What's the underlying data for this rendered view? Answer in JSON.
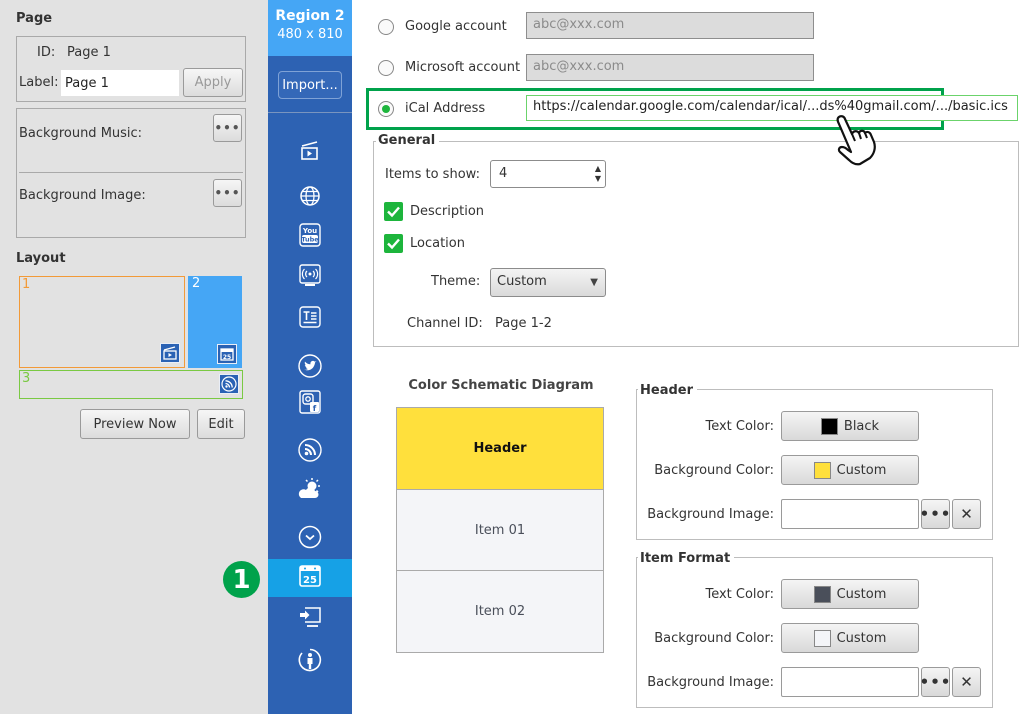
{
  "page_panel": {
    "title": "Page",
    "id_label": "ID:",
    "id_value": "Page 1",
    "label_label": "Label:",
    "label_value": "Page 1",
    "apply_button": "Apply",
    "bg_music_label": "Background Music:",
    "bg_image_label": "Background Image:",
    "browse_button": "•••"
  },
  "layout_panel": {
    "title": "Layout",
    "regions": [
      {
        "number": "1",
        "icon": "video-icon",
        "color": "#f29a38"
      },
      {
        "number": "2",
        "icon": "calendar-icon",
        "color": "#45a6f5",
        "selected": true
      },
      {
        "number": "3",
        "icon": "rss-icon",
        "color": "#7ac943"
      }
    ],
    "preview_button": "Preview Now",
    "edit_button": "Edit"
  },
  "sidebar": {
    "region_title": "Region 2",
    "region_size": "480 x 810",
    "import_button": "Import...",
    "items": [
      {
        "name": "video",
        "icon": "video-icon"
      },
      {
        "name": "web",
        "icon": "globe-icon"
      },
      {
        "name": "youtube",
        "icon": "youtube-icon"
      },
      {
        "name": "live-stream",
        "icon": "stream-icon"
      },
      {
        "name": "text",
        "icon": "text-icon"
      },
      {
        "name": "twitter",
        "icon": "twitter-icon"
      },
      {
        "name": "instagram-facebook",
        "icon": "social-icon"
      },
      {
        "name": "rss",
        "icon": "rss-icon"
      },
      {
        "name": "weather",
        "icon": "weather-icon"
      },
      {
        "name": "more",
        "icon": "chevron-down-circle-icon"
      },
      {
        "name": "calendar",
        "icon": "calendar-icon",
        "active": true,
        "day": "25"
      },
      {
        "name": "input",
        "icon": "input-source-icon"
      },
      {
        "name": "people",
        "icon": "person-icon"
      }
    ],
    "active_color": "#16a1e6"
  },
  "step_badge": "1",
  "accounts": {
    "google_label": "Google account",
    "google_placeholder": "abc@xxx.com",
    "microsoft_label": "Microsoft account",
    "microsoft_placeholder": "abc@xxx.com",
    "ical_label": "iCal Address",
    "ical_value": "https://calendar.google.com/calendar/ical/...ds%40gmail.com/.../basic.ics",
    "selected": "ical"
  },
  "general": {
    "legend": "General",
    "items_label": "Items to show:",
    "items_value": "4",
    "description_label": "Description",
    "description_checked": true,
    "location_label": "Location",
    "location_checked": true,
    "theme_label": "Theme:",
    "theme_value": "Custom",
    "channel_label": "Channel ID:",
    "channel_value": "Page 1-2"
  },
  "diagram": {
    "title": "Color Schematic Diagram",
    "header_text": "Header",
    "items": [
      "Item 01",
      "Item 02"
    ],
    "header_bg": "#ffe03c",
    "item_bg": "#f4f5f8"
  },
  "header_format": {
    "legend": "Header",
    "text_color_label": "Text Color:",
    "text_color_value": "Black",
    "text_color_swatch": "#000000",
    "bg_color_label": "Background Color:",
    "bg_color_value": "Custom",
    "bg_color_swatch": "#ffe03c",
    "bg_image_label": "Background Image:",
    "browse": "•••",
    "clear": "✕"
  },
  "item_format": {
    "legend": "Item Format",
    "text_color_label": "Text Color:",
    "text_color_value": "Custom",
    "text_color_swatch": "#4a4f5a",
    "bg_color_label": "Background Color:",
    "bg_color_value": "Custom",
    "bg_color_swatch": "#f4f5f8",
    "bg_image_label": "Background Image:",
    "browse": "•••",
    "clear": "✕"
  }
}
